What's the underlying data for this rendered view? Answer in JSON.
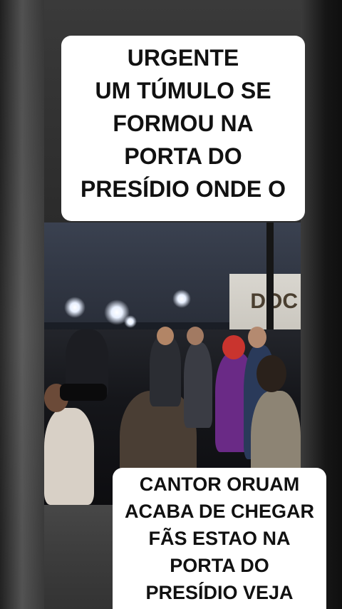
{
  "caption_top": {
    "lines": [
      "URGENTE",
      "UM TÚMULO SE",
      "FORMOU NA",
      "PORTA DO",
      "PRESÍDIO ONDE O"
    ]
  },
  "caption_bottom": {
    "lines": [
      "CANTOR ORUAM",
      "ACABA DE CHEGAR",
      "FÃS ESTAO NA",
      "PORTA DO",
      "PRESÍDIO VEJA"
    ]
  },
  "video": {
    "background_sign": "DOC"
  }
}
